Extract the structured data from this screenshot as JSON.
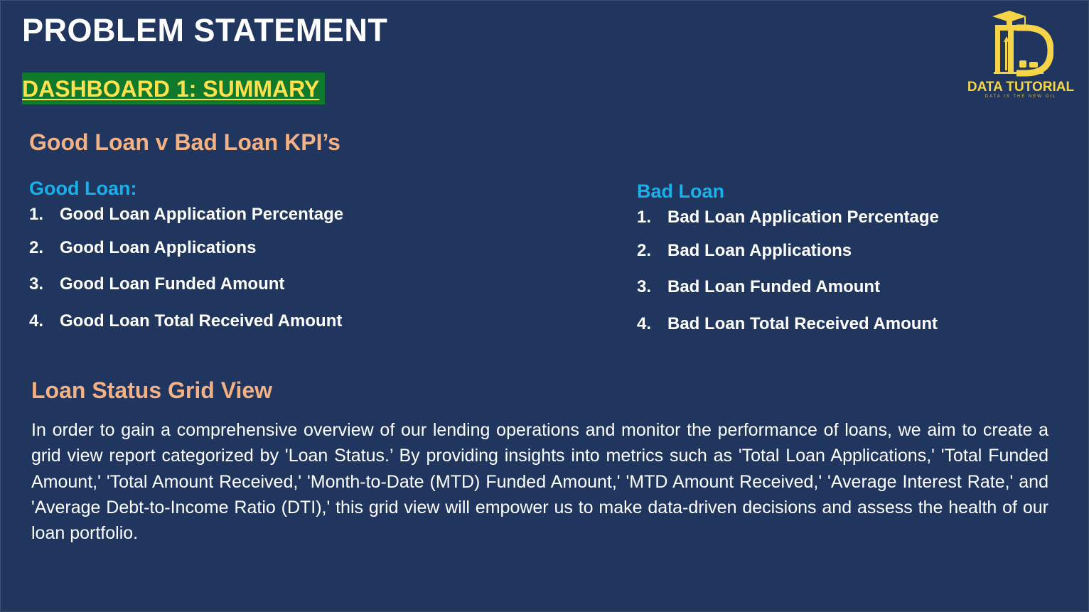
{
  "title": "PROBLEM STATEMENT",
  "dashboard_label": "DASHBOARD 1: SUMMARY",
  "logo": {
    "name": "DATA TUTORIAL",
    "tagline": "DATA IS THE NEW OIL",
    "color": "#f5d547"
  },
  "kpi_section": {
    "heading": "Good Loan v Bad Loan KPI’s",
    "good": {
      "heading": "Good Loan:",
      "items": [
        {
          "num": "1.",
          "label": "Good Loan Application Percentage"
        },
        {
          "num": "2.",
          "label": "Good Loan Applications"
        },
        {
          "num": "3.",
          "label": "Good Loan Funded Amount"
        },
        {
          "num": "4.",
          "label": "Good Loan Total Received Amount"
        }
      ]
    },
    "bad": {
      "heading": "Bad Loan",
      "items": [
        {
          "num": "1.",
          "label": "Bad Loan Application Percentage"
        },
        {
          "num": "2.",
          "label": "Bad Loan Applications"
        },
        {
          "num": "3.",
          "label": "Bad Loan Funded Amount"
        },
        {
          "num": "4.",
          "label": "Bad Loan Total Received Amount"
        }
      ]
    }
  },
  "grid_section": {
    "heading": "Loan Status Grid View",
    "body": "In order to gain a comprehensive overview of our lending operations and monitor the performance of loans, we aim to create a grid view report categorized by 'Loan Status.’ By providing insights into metrics such as 'Total Loan Applications,' 'Total Funded Amount,' 'Total Amount Received,' 'Month-to-Date (MTD) Funded Amount,' 'MTD Amount Received,' 'Average Interest Rate,' and 'Average Debt-to-Income Ratio (DTI),' this grid view will empower us to make data-driven decisions and assess the health of our loan portfolio."
  },
  "colors": {
    "background": "#20365f",
    "section_heading": "#f4b183",
    "column_heading": "#1ab0ea",
    "badge_background": "#0f7a2c",
    "badge_text": "#ffe14d"
  }
}
